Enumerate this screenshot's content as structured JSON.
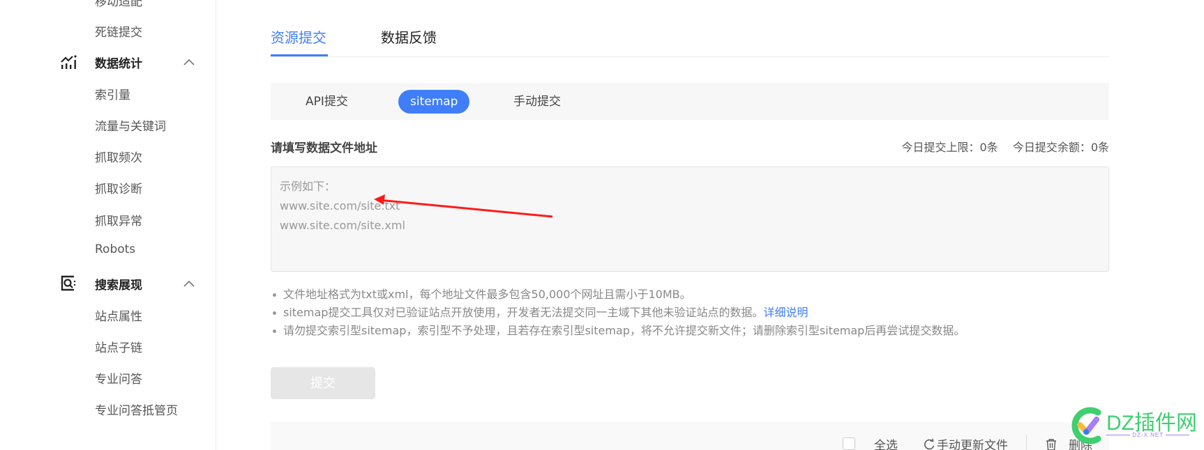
{
  "sidebar": {
    "partial_top_item": "移动适配",
    "items_before": [
      {
        "label": "死链提交"
      }
    ],
    "groups": [
      {
        "label": "数据统计",
        "icon": "chart-icon",
        "expanded": true,
        "items": [
          {
            "label": "索引量"
          },
          {
            "label": "流量与关键词"
          },
          {
            "label": "抓取频次"
          },
          {
            "label": "抓取诊断"
          },
          {
            "label": "抓取异常"
          },
          {
            "label": "Robots"
          }
        ]
      },
      {
        "label": "搜索展现",
        "icon": "search-display-icon",
        "expanded": true,
        "items": [
          {
            "label": "站点属性"
          },
          {
            "label": "站点子链"
          },
          {
            "label": "专业问答"
          },
          {
            "label": "专业问答抵管页"
          }
        ]
      }
    ]
  },
  "main": {
    "top_tabs": [
      {
        "label": "资源提交",
        "active": true
      },
      {
        "label": "数据反馈",
        "active": false
      }
    ],
    "sub_tabs": [
      {
        "label": "API提交",
        "active": false
      },
      {
        "label": "sitemap",
        "active": true
      },
      {
        "label": "手动提交",
        "active": false
      }
    ],
    "form_label": "请填写数据文件地址",
    "quota": {
      "limit": "今日提交上限：0条",
      "remaining": "今日提交余额：0条"
    },
    "textarea": {
      "placeholder_lines": [
        "示例如下：",
        "www.site.com/site.txt",
        "www.site.com/site.xml"
      ]
    },
    "notes": [
      {
        "text": "文件地址格式为txt或xml，每个地址文件最多包含50,000个网址且需小于10MB。"
      },
      {
        "text": "sitemap提交工具仅对已验证站点开放使用，开发者无法提交同一主域下其他未验证站点的数据。",
        "link": "详细说明"
      },
      {
        "text": "请勿提交索引型sitemap，索引型不予处理，且若存在索引型sitemap，将不允许提交新文件；请删除索引型sitemap后再尝试提交数据。"
      }
    ],
    "submit_label": "提交",
    "toolbar": {
      "select_all": "全选",
      "refresh": "手动更新文件",
      "delete": "删除"
    }
  },
  "annotation": {
    "arrow_color": "#ff1a1a"
  },
  "watermark": {
    "title": "DZ插件网",
    "subtitle": "DZ-X.NET"
  },
  "colors": {
    "accent": "#3f7ef8",
    "watermark_green": "#3ecf6e",
    "watermark_purple": "#a67ff5"
  }
}
